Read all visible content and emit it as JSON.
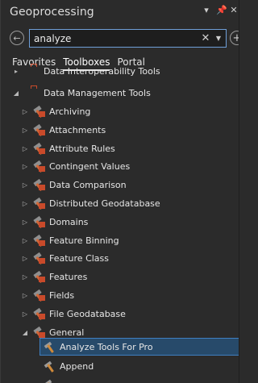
{
  "window": {
    "title": "Geoprocessing",
    "pin_icon": "pin-icon",
    "menu_icon": "menu-icon",
    "close_icon": "close-icon"
  },
  "search": {
    "value": "analyze",
    "clear_icon": "clear-icon",
    "dropdown_icon": "dropdown-icon"
  },
  "tabs": [
    "Favorites",
    "Toolboxes",
    "Portal"
  ],
  "active_tab": "Toolboxes",
  "tree": {
    "rows": [
      {
        "label": "Data Interoperability Tools",
        "kind": "toolbox",
        "state": "collapsed"
      },
      {
        "label": "Data Management Tools",
        "kind": "toolbox",
        "state": "expanded"
      },
      {
        "label": "Archiving",
        "kind": "toolset",
        "state": "collapsed"
      },
      {
        "label": "Attachments",
        "kind": "toolset",
        "state": "collapsed"
      },
      {
        "label": "Attribute Rules",
        "kind": "toolset",
        "state": "collapsed"
      },
      {
        "label": "Contingent Values",
        "kind": "toolset",
        "state": "collapsed"
      },
      {
        "label": "Data Comparison",
        "kind": "toolset",
        "state": "collapsed"
      },
      {
        "label": "Distributed Geodatabase",
        "kind": "toolset",
        "state": "collapsed"
      },
      {
        "label": "Domains",
        "kind": "toolset",
        "state": "collapsed"
      },
      {
        "label": "Feature Binning",
        "kind": "toolset",
        "state": "collapsed"
      },
      {
        "label": "Feature Class",
        "kind": "toolset",
        "state": "collapsed"
      },
      {
        "label": "Features",
        "kind": "toolset",
        "state": "collapsed"
      },
      {
        "label": "Fields",
        "kind": "toolset",
        "state": "collapsed"
      },
      {
        "label": "File Geodatabase",
        "kind": "toolset",
        "state": "collapsed"
      },
      {
        "label": "General",
        "kind": "toolset",
        "state": "expanded"
      },
      {
        "label": "Analyze Tools For Pro",
        "kind": "tool",
        "state": "selected"
      },
      {
        "label": "Append",
        "kind": "tool",
        "state": "none"
      }
    ]
  }
}
